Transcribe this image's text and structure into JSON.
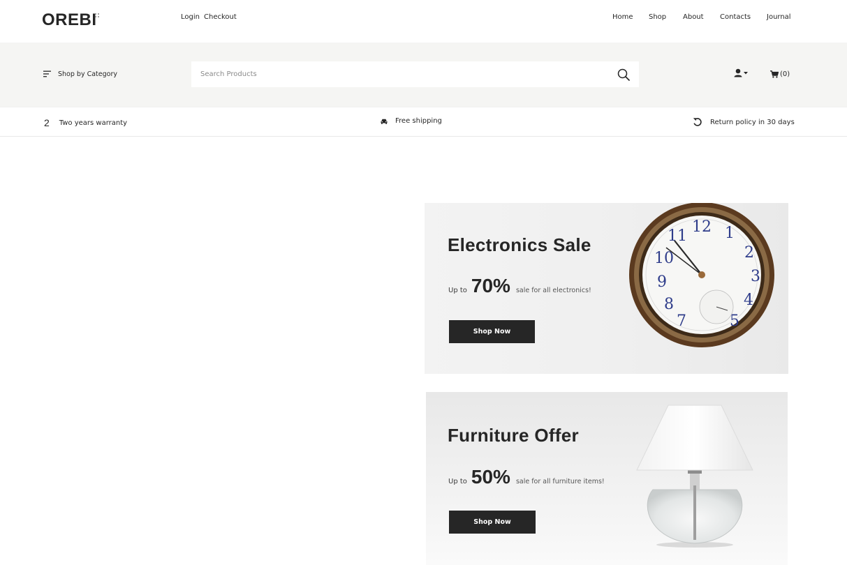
{
  "brand": {
    "logo": "OREBI"
  },
  "top_links": {
    "login": "Login",
    "checkout": "Checkout"
  },
  "nav": [
    {
      "label": "Home"
    },
    {
      "label": "Shop"
    },
    {
      "label": "About"
    },
    {
      "label": "Contacts"
    },
    {
      "label": "Journal"
    }
  ],
  "search_bar": {
    "category_label": "Shop by Category",
    "placeholder": "Search Products",
    "cart_count": "(0)"
  },
  "features": {
    "warranty_number": "2",
    "warranty": "Two years warranty",
    "shipping": "Free shipping",
    "returns": "Return policy in 30 days"
  },
  "banners": [
    {
      "title": "Electronics Sale",
      "up_to": "Up to",
      "percent": "70%",
      "description": "sale for all electronics!",
      "button": "Shop Now"
    },
    {
      "title": "Furniture Offer",
      "up_to": "Up to",
      "percent": "50%",
      "description": "sale for all furniture items!",
      "button": "Shop Now"
    }
  ],
  "colors": {
    "text": "#262626",
    "band_bg": "#f5f5f3",
    "button_bg": "#262626"
  },
  "icons": [
    "menu-lines-icon",
    "search-icon",
    "user-icon",
    "caret-down-icon",
    "cart-icon",
    "car-icon",
    "return-icon"
  ]
}
